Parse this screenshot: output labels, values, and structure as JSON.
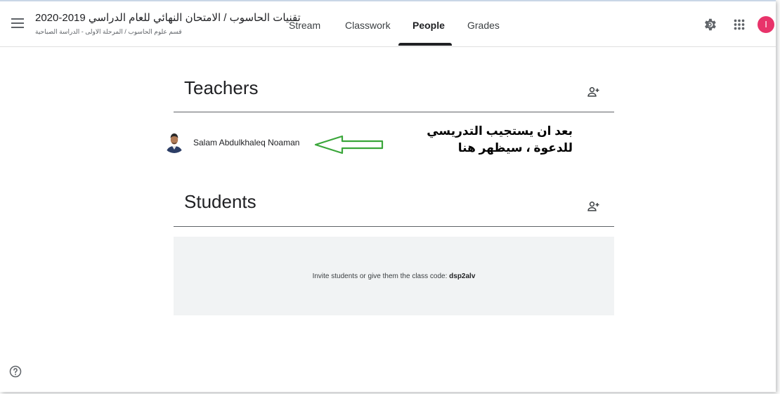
{
  "header": {
    "class_title": "تقنيات الحاسوب / الامتحان النهائي للعام الدراسي 2019-2020",
    "class_subtitle": "قسم علوم الحاسوب / المرحلة الاولى - الدراسة الصباحية",
    "tabs": [
      {
        "label": "Stream",
        "active": false
      },
      {
        "label": "Classwork",
        "active": false
      },
      {
        "label": "People",
        "active": true
      },
      {
        "label": "Grades",
        "active": false
      }
    ],
    "user_initial": "I",
    "avatar_color": "#e8336a",
    "icons": [
      "menu-icon",
      "gear-icon",
      "apps-grid-icon"
    ]
  },
  "teachers": {
    "title": "Teachers",
    "members": [
      {
        "name": "Salam Abdulkhaleq Noaman"
      }
    ]
  },
  "annotation": {
    "line1": "بعد ان يستجيب التدريسي",
    "line2": "للدعوة ، سيظهر هنا",
    "arrow_color": "#3aa63a"
  },
  "students": {
    "title": "Students",
    "invite_text": "Invite students or give them the class code:",
    "class_code": "dsp2alv"
  },
  "footer": {
    "help_icon": "help-circle-icon"
  }
}
